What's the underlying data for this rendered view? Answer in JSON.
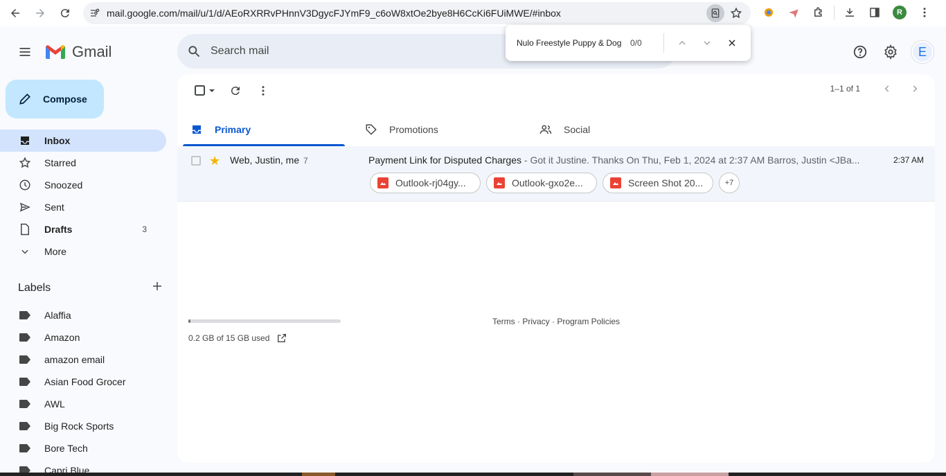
{
  "browser": {
    "url": "mail.google.com/mail/u/1/d/AEoRXRRvPHnnV3DgycFJYmF9_c6oW8xtOe2bye8H6CcKi6FUiMWE/#inbox",
    "profile_initial": "R"
  },
  "find_bar": {
    "query": "Nulo Freestyle Puppy & Dog",
    "count": "0/0"
  },
  "header": {
    "app_name": "Gmail",
    "search_placeholder": "Search mail",
    "avatar_initial": "E"
  },
  "sidebar": {
    "compose_label": "Compose",
    "items": [
      {
        "label": "Inbox",
        "count": ""
      },
      {
        "label": "Starred",
        "count": ""
      },
      {
        "label": "Snoozed",
        "count": ""
      },
      {
        "label": "Sent",
        "count": ""
      },
      {
        "label": "Drafts",
        "count": "3"
      },
      {
        "label": "More",
        "count": ""
      }
    ],
    "labels_heading": "Labels",
    "labels": [
      "Alaffia",
      "Amazon",
      "amazon email",
      "Asian Food Grocer",
      "AWL",
      "Big Rock Sports",
      "Bore Tech",
      "Capri Blue"
    ]
  },
  "toolbar": {
    "pagination": "1–1 of 1"
  },
  "tabs": [
    {
      "label": "Primary"
    },
    {
      "label": "Promotions"
    },
    {
      "label": "Social"
    }
  ],
  "email": {
    "sender": "Web, Justin, me",
    "thread_count": "7",
    "subject": "Payment Link for Disputed Charges",
    "snippet": " - Got it Justine. Thanks On Thu, Feb 1, 2024 at 2:37 AM Barros, Justin <JBa...",
    "time": "2:37 AM",
    "attachments": [
      "Outlook-rj04gy...",
      "Outlook-gxo2e...",
      "Screen Shot 20..."
    ],
    "more_attachments": "+7"
  },
  "storage": {
    "text": "0.2 GB of 15 GB used",
    "used_fraction": 0.013
  },
  "footer": {
    "links": "Terms · Privacy · Program Policies"
  },
  "colors": {
    "accent": "#0b57d0",
    "compose_bg": "#c2e7ff",
    "active_nav": "#d3e3fd",
    "star": "#f4b400"
  }
}
